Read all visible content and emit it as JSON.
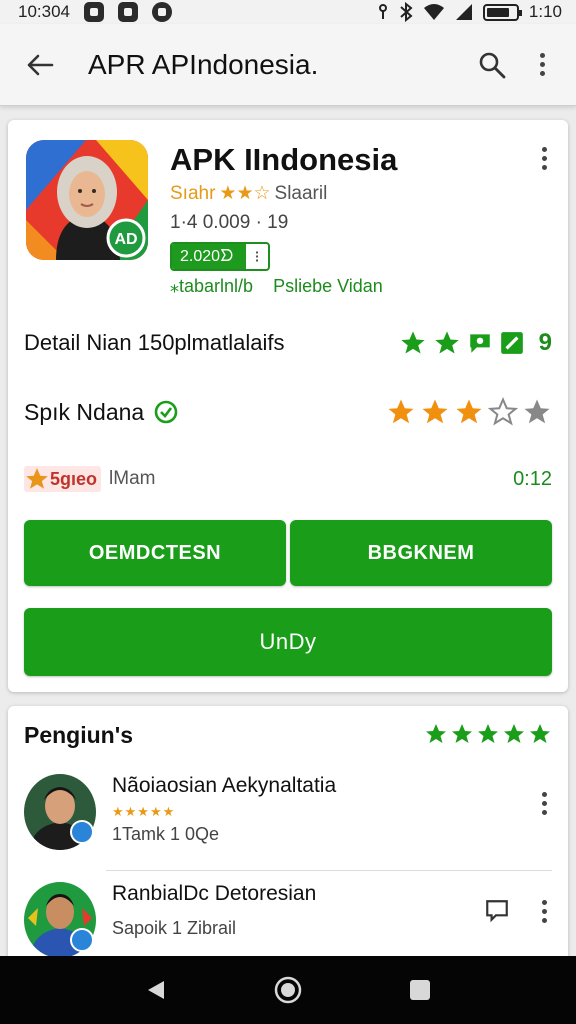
{
  "status_bar": {
    "time": "10:304",
    "clock_right": "1:10"
  },
  "app_bar": {
    "title": "APR APIndonesia.",
    "back_icon": "arrow-left-icon",
    "search_icon": "search-icon",
    "menu_icon": "more-vert-icon"
  },
  "app": {
    "name": "APK IIndonesia",
    "developer_prefix": "Sıahr",
    "developer_stars": "★★☆",
    "developer_suffix": "Slaaril",
    "meta": "1·4 0.009 · 19",
    "badge_value": "2.020ᗤ",
    "badge_end": "⁝",
    "tag_left": "⁎tabarlnl/b",
    "tag_right": "Psliebe Vidan"
  },
  "detail": {
    "label": "Detail Nian  150plmatlalaifs",
    "count": "9"
  },
  "rating": {
    "label": "Spık Ndana",
    "stars_full": 3,
    "stars_empty": 2
  },
  "price": {
    "value": "5gıeo",
    "sub": "lMam",
    "time": "0:12"
  },
  "buttons": {
    "left": "OEMDCTESN",
    "right": "BBGKNEM",
    "wide": "UnDy"
  },
  "reviews": {
    "title": "Pengiun's",
    "title_stars": "★★★★★",
    "items": [
      {
        "name": "Nãoiaosian Aekynaltatia",
        "stars": "★★★★★",
        "date": "1Tamk 1 0Qe"
      },
      {
        "name": "RanbialDc Detoresian",
        "date": "Sapoik 1 Zibrail"
      }
    ]
  },
  "colors": {
    "accent_green": "#1a9e1a",
    "star_orange": "#f0900e",
    "price_red": "#c0342b"
  }
}
